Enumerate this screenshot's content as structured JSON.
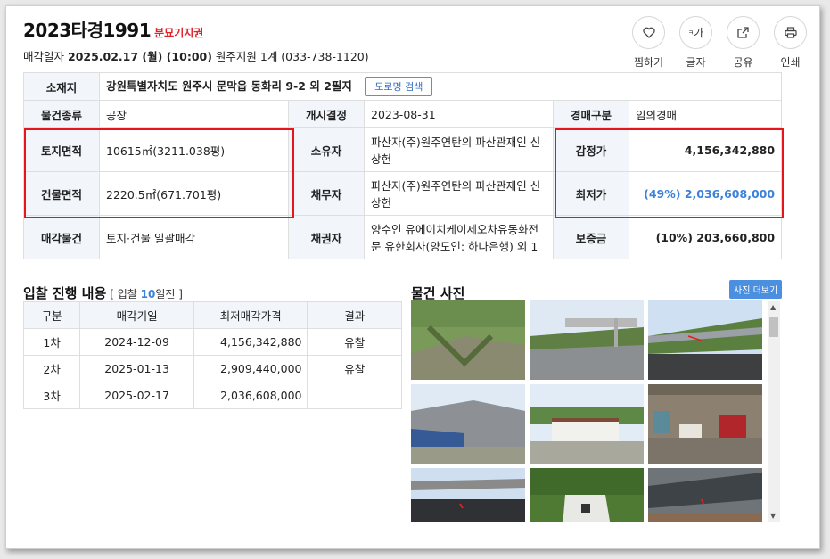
{
  "header": {
    "case_no": "2023타경1991",
    "tag": "분묘기지권",
    "sale_label": "매각일자",
    "sale_date": "2025.02.17 (월) (10:00)",
    "sale_court": "원주지원 1계 (033-738-1120)"
  },
  "actions": [
    {
      "label": "찜하기",
      "icon": "heart-icon"
    },
    {
      "label": "글자",
      "icon": "text-size-icon",
      "glyph": "가"
    },
    {
      "label": "공유",
      "icon": "share-icon"
    },
    {
      "label": "인쇄",
      "icon": "print-icon"
    }
  ],
  "info": {
    "location_label": "소재지",
    "location": "강원특별자치도 원주시 문막읍 동화리 9-2 외 2필지",
    "road_search": "도로명 검색",
    "type_label": "물건종류",
    "type": "공장",
    "start_label": "개시결정",
    "start": "2023-08-31",
    "auction_type_label": "경매구분",
    "auction_type": "임의경매",
    "land_label": "토지면적",
    "land": "10615㎡(3211.038평)",
    "owner_label": "소유자",
    "owner": "파산자(주)원주연탄의 파산관재인 신상헌",
    "appraisal_label": "감정가",
    "appraisal": "4,156,342,880",
    "building_label": "건물면적",
    "building": "2220.5㎡(671.701평)",
    "debtor_label": "채무자",
    "debtor": "파산자(주)원주연탄의 파산관재인 신상헌",
    "min_label": "최저가",
    "min": "(49%) 2,036,608,000",
    "sale_item_label": "매각물건",
    "sale_item": "토지·건물 일괄매각",
    "creditor_label": "채권자",
    "creditor": "양수인 유에이치케이제오차유동화전문 유한회사(양도인: 하나은행) 외 1",
    "deposit_label": "보증금",
    "deposit": "(10%) 203,660,800"
  },
  "bids": {
    "title": "입찰 진행 내용",
    "sub_prefix": "[ 입찰 ",
    "sub_days": "10",
    "sub_suffix": "일전 ]",
    "headers": [
      "구분",
      "매각기일",
      "최저매각가격",
      "결과"
    ],
    "rows": [
      {
        "round": "1차",
        "date": "2024-12-09",
        "price": "4,156,342,880",
        "result": "유찰"
      },
      {
        "round": "2차",
        "date": "2025-01-13",
        "price": "2,909,440,000",
        "result": "유찰"
      },
      {
        "round": "3차",
        "date": "2025-02-17",
        "price": "2,036,608,000",
        "result": ""
      }
    ]
  },
  "photos": {
    "title": "물건 사진",
    "more": "사진 더보기"
  },
  "colors": {
    "accent": "#3d82d8",
    "highlight": "#e5151c",
    "tag": "#e0242b"
  }
}
